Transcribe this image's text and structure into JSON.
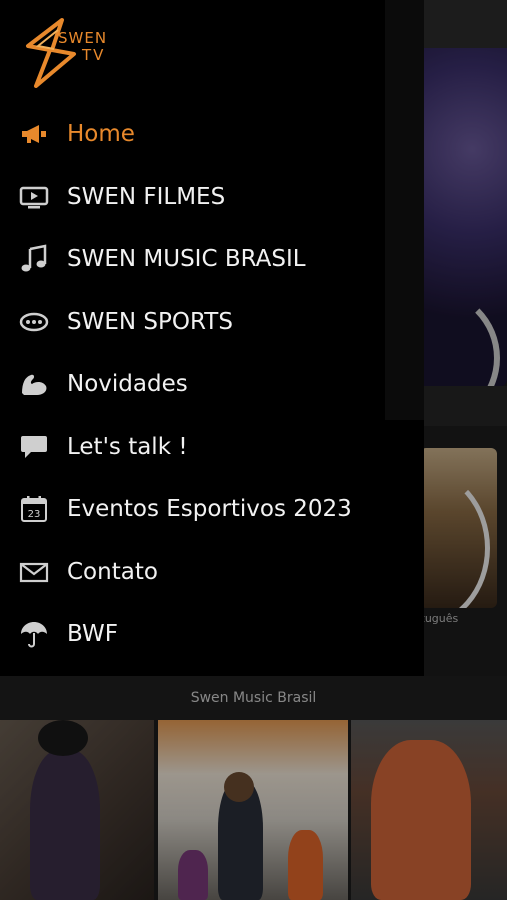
{
  "app": {
    "logo_line1": "SWEN",
    "logo_line2": "TV",
    "accent_color": "#e8892c"
  },
  "drawer": {
    "items": [
      {
        "label": "Home",
        "icon": "megaphone-icon",
        "active": true
      },
      {
        "label": "SWEN FILMES",
        "icon": "tv-icon",
        "active": false
      },
      {
        "label": "SWEN MUSIC BRASIL",
        "icon": "music-note-icon",
        "active": false
      },
      {
        "label": "SWEN SPORTS",
        "icon": "sports-ball-icon",
        "active": false
      },
      {
        "label": "Novidades",
        "icon": "muscle-arm-icon",
        "active": false
      },
      {
        "label": "Let's talk !",
        "icon": "chat-bubble-icon",
        "active": false
      },
      {
        "label": "Eventos Esportivos 2023",
        "icon": "calendar-icon",
        "active": false
      },
      {
        "label": "Contato",
        "icon": "envelope-icon",
        "active": false
      },
      {
        "label": "BWF",
        "icon": "umbrella-icon",
        "active": false
      }
    ]
  },
  "calendar_icon_day": "23",
  "background": {
    "card_caption": "rtuguês",
    "section_title": "Swen Music Brasil"
  }
}
